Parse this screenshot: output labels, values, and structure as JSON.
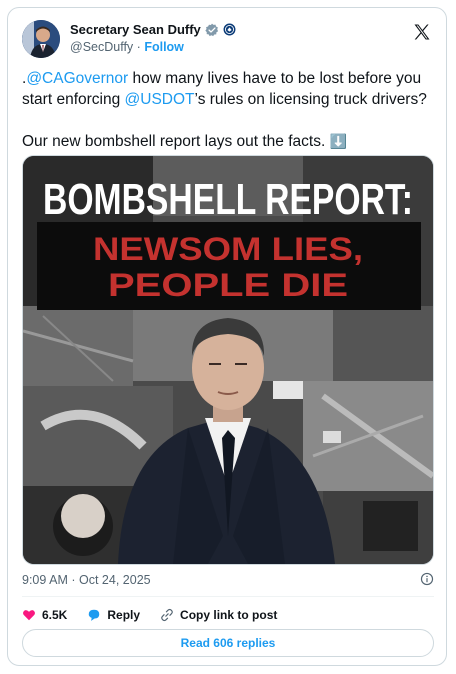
{
  "author": {
    "name": "Secretary Sean Duffy",
    "handle": "@SecDuffy",
    "separator": "·",
    "follow_label": "Follow",
    "verified_icon": "verified-badge-icon",
    "affiliation_icon": "government-affiliation-icon"
  },
  "platform": {
    "logo": "x-logo-icon"
  },
  "tweet": {
    "line1_pre": ".",
    "mention1": "@CAGovernor",
    "line1_post": " how many lives have to be lost before you start enforcing ",
    "mention2": "@USDOT",
    "line1_end": "’s rules on licensing truck drivers?",
    "line2": "Our new bombshell report lays out the facts.",
    "emoji": "⬇️"
  },
  "media": {
    "headline_top": "BOMBSHELL REPORT:",
    "headline_line1": "NEWSOM LIES,",
    "headline_line2": "PEOPLE DIE"
  },
  "meta": {
    "time": "9:09 AM",
    "date": "Oct 24, 2025",
    "separator": "·"
  },
  "actions": {
    "likes": "6.5K",
    "reply_label": "Reply",
    "copy_label": "Copy link to post"
  },
  "replies_button": "Read 606 replies",
  "colors": {
    "accent": "#1d9bf0",
    "like": "#f91880",
    "headline_red": "#c4322f"
  }
}
